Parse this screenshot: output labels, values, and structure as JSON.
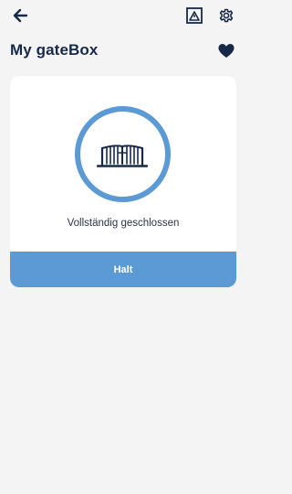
{
  "header": {
    "back_icon": "arrow-left-icon",
    "control_icon": "gate-control-icon",
    "settings_icon": "gear-icon",
    "title": "My gateBox",
    "favorite_icon": "heart-icon"
  },
  "card": {
    "status_icon": "gate-icon",
    "status_text": "Vollständig geschlossen",
    "halt_label": "Halt"
  },
  "colors": {
    "accent": "#5b9ad5",
    "title": "#17294a",
    "background": "#f4f4f4"
  }
}
